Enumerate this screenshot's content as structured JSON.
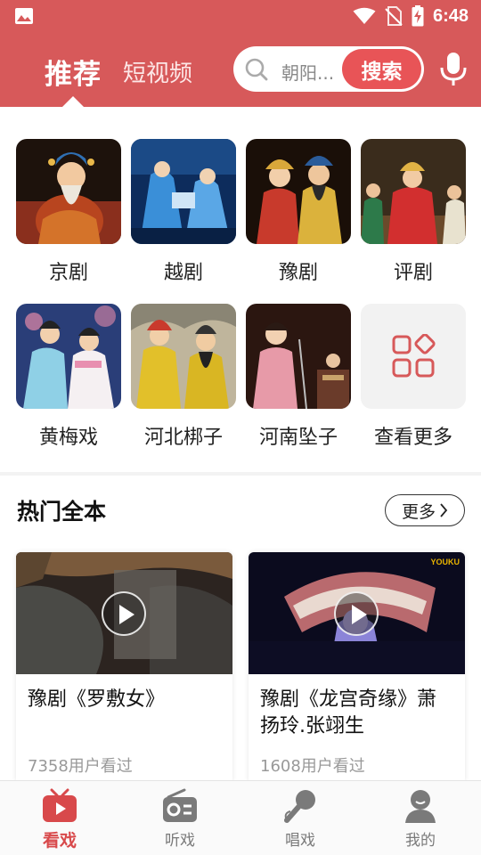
{
  "status_bar": {
    "time": "6:48"
  },
  "header": {
    "tabs": [
      {
        "label": "推荐",
        "active": true
      },
      {
        "label": "短视频",
        "active": false
      }
    ],
    "search": {
      "placeholder": "朝阳...",
      "button_label": "搜索"
    },
    "accent_color": "#d7595a"
  },
  "categories": [
    {
      "label": "京剧"
    },
    {
      "label": "越剧"
    },
    {
      "label": "豫剧"
    },
    {
      "label": "评剧"
    },
    {
      "label": "黄梅戏"
    },
    {
      "label": "河北梆子"
    },
    {
      "label": "河南坠子"
    },
    {
      "label": "查看更多",
      "icon": "grid-apps-icon"
    }
  ],
  "hot_section": {
    "title": "热门全本",
    "more_label": "更多",
    "videos": [
      {
        "title": "豫剧《罗敷女》",
        "views": "7358用户看过"
      },
      {
        "title": "豫剧《龙宫奇缘》萧扬玲.张翊生",
        "views": "1608用户看过",
        "watermark": "YOUKU"
      }
    ]
  },
  "bottom_nav": [
    {
      "label": "看戏",
      "icon": "tv-icon",
      "active": true
    },
    {
      "label": "听戏",
      "icon": "radio-icon",
      "active": false
    },
    {
      "label": "唱戏",
      "icon": "microphone-icon",
      "active": false
    },
    {
      "label": "我的",
      "icon": "user-icon",
      "active": false
    }
  ]
}
